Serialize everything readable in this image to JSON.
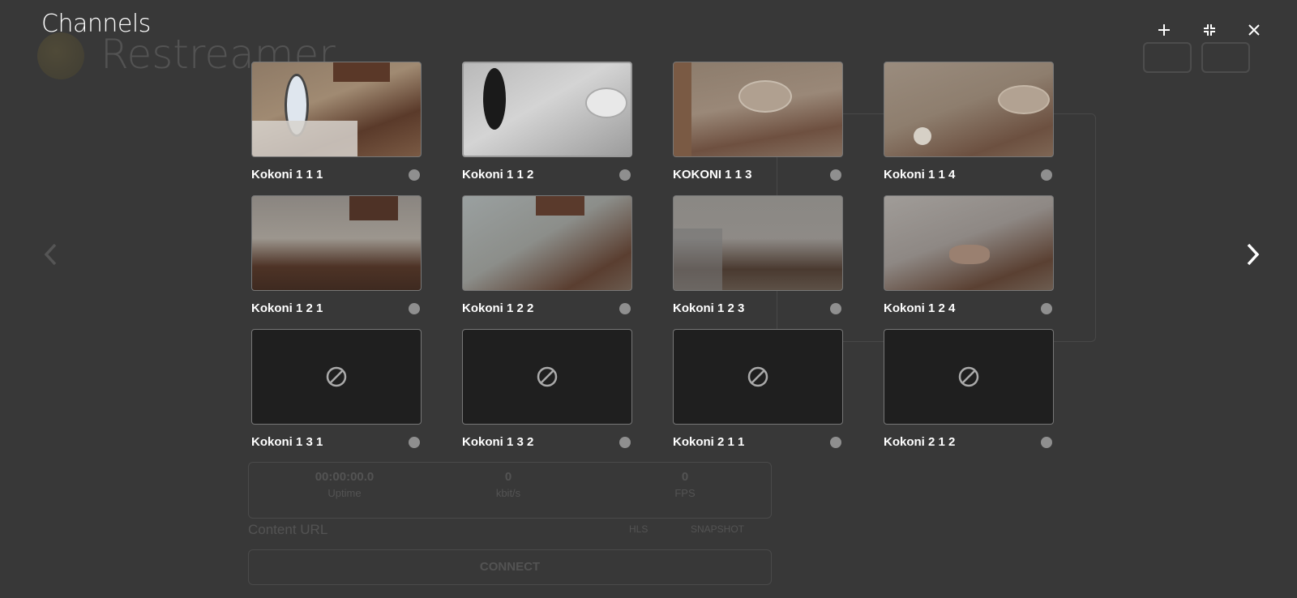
{
  "background": {
    "app_title": "Restreamer",
    "stats": [
      {
        "value": "00:00:00.0",
        "label": "Uptime"
      },
      {
        "value": "0",
        "label": "kbit/s"
      },
      {
        "value": "0",
        "label": "FPS"
      }
    ],
    "content_url_label": "Content URL",
    "link_hls": "HLS",
    "link_snapshot": "SNAPSHOT",
    "connect_label": "CONNECT"
  },
  "header": {
    "title": "Channels",
    "add_icon": "plus-icon",
    "collapse_icon": "collapse-icon",
    "close_icon": "close-icon"
  },
  "navigation": {
    "prev_icon": "chevron-left-icon",
    "next_icon": "chevron-right-icon"
  },
  "channels": [
    {
      "name": "Kokoni 1 1 1",
      "has_preview": true
    },
    {
      "name": "Kokoni 1 1 2",
      "has_preview": true,
      "selected": true
    },
    {
      "name": "KOKONI 1 1 3",
      "has_preview": true
    },
    {
      "name": "Kokoni 1 1 4",
      "has_preview": true
    },
    {
      "name": "Kokoni 1 2 1",
      "has_preview": true
    },
    {
      "name": "Kokoni 1 2 2",
      "has_preview": true
    },
    {
      "name": "Kokoni 1 2 3",
      "has_preview": true
    },
    {
      "name": "Kokoni 1 2 4",
      "has_preview": true
    },
    {
      "name": "Kokoni 1 3 1",
      "has_preview": false
    },
    {
      "name": "Kokoni 1 3 2",
      "has_preview": false
    },
    {
      "name": "Kokoni 2 1 1",
      "has_preview": false
    },
    {
      "name": "Kokoni 2 1 2",
      "has_preview": false
    }
  ],
  "colors": {
    "overlay_bg": "#383838",
    "status_dot": "#8f8f8f",
    "empty_thumb": "#1f1f1f"
  }
}
